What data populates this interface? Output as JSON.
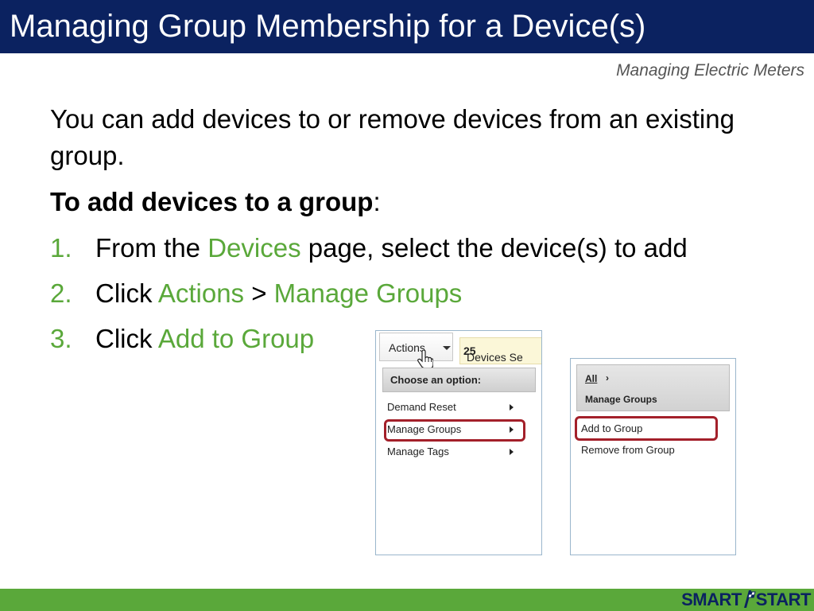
{
  "header": {
    "title": "Managing Group Membership for a Device(s)",
    "subtitle": "Managing Electric Meters"
  },
  "content": {
    "intro": "You can add devices to or remove devices from an existing group.",
    "heading": "To add devices to a group",
    "heading_colon": ":",
    "steps": [
      {
        "num": "1.",
        "pre": "From the ",
        "link": "Devices",
        "post": " page, select the device(s) to add"
      },
      {
        "num": "2.",
        "pre": "Click ",
        "link": "Actions",
        "sep": " > ",
        "link2": "Manage Groups"
      },
      {
        "num": "3.",
        "pre": "Click ",
        "link": "Add to Group"
      }
    ]
  },
  "screenshot1": {
    "actions_label": "Actions",
    "devices_count": "25",
    "devices_text": " Devices Se",
    "menu_header": "Choose an option:",
    "menu_items": [
      "Demand Reset",
      "Manage Groups",
      "Manage Tags"
    ]
  },
  "screenshot2": {
    "breadcrumb_all": "All",
    "breadcrumb_sep": "›",
    "breadcrumb_title": "Manage Groups",
    "options": [
      "Add to Group",
      "Remove from Group"
    ]
  },
  "footer": {
    "logo_left": "SMART",
    "logo_right": "START"
  },
  "colors": {
    "title_bar": "#0b2260",
    "accent_green": "#5aa83a",
    "highlight_red": "#a3202a"
  }
}
